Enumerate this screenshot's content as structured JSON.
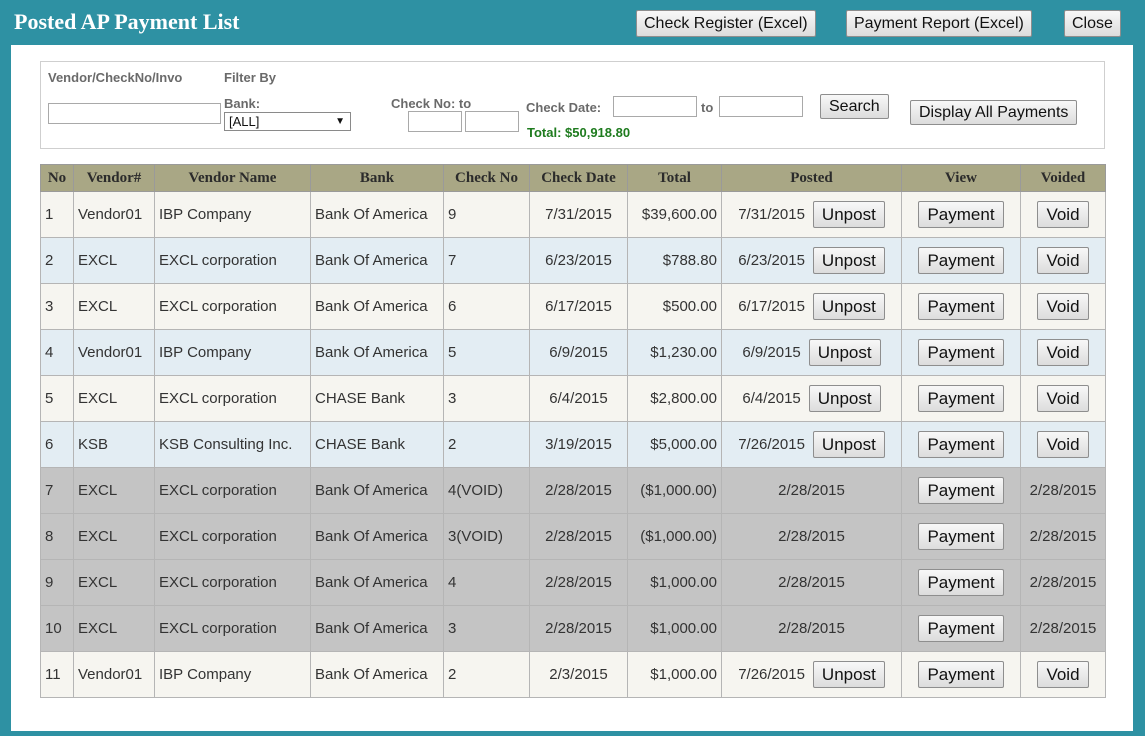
{
  "header": {
    "title": "Posted AP Payment List",
    "check_register_label": "Check Register (Excel)",
    "payment_report_label": "Payment Report (Excel)",
    "close_label": "Close"
  },
  "filter": {
    "vendor_label": "Vendor/CheckNo/Invo",
    "vendor_value": "",
    "filter_by_label": "Filter By",
    "bank_label": "Bank:",
    "bank_selected": "[ALL]",
    "check_no_label": "Check No: to",
    "check_no_from": "",
    "check_no_to": "",
    "check_date_label": "Check Date:",
    "check_date_from": "",
    "to_label": "to",
    "check_date_to": "",
    "search_label": "Search",
    "display_all_label": "Display All Payments",
    "total_text": "Total: $50,918.80"
  },
  "table": {
    "columns": [
      "No",
      "Vendor#",
      "Vendor Name",
      "Bank",
      "Check No",
      "Check Date",
      "Total",
      "Posted",
      "View",
      "Voided"
    ],
    "unpost_label": "Unpost",
    "payment_label": "Payment",
    "void_label": "Void",
    "rows": [
      {
        "no": "1",
        "vendor": "Vendor01",
        "vendor_name": "IBP Company",
        "bank": "Bank Of America",
        "check_no": "9",
        "check_date": "7/31/2015",
        "total": "$39,600.00",
        "posted": "7/31/2015",
        "voided": "",
        "is_void": false
      },
      {
        "no": "2",
        "vendor": "EXCL",
        "vendor_name": "EXCL corporation",
        "bank": "Bank Of America",
        "check_no": "7",
        "check_date": "6/23/2015",
        "total": "$788.80",
        "posted": "6/23/2015",
        "voided": "",
        "is_void": false
      },
      {
        "no": "3",
        "vendor": "EXCL",
        "vendor_name": "EXCL corporation",
        "bank": "Bank Of America",
        "check_no": "6",
        "check_date": "6/17/2015",
        "total": "$500.00",
        "posted": "6/17/2015",
        "voided": "",
        "is_void": false
      },
      {
        "no": "4",
        "vendor": "Vendor01",
        "vendor_name": "IBP Company",
        "bank": "Bank Of America",
        "check_no": "5",
        "check_date": "6/9/2015",
        "total": "$1,230.00",
        "posted": "6/9/2015",
        "voided": "",
        "is_void": false
      },
      {
        "no": "5",
        "vendor": "EXCL",
        "vendor_name": "EXCL corporation",
        "bank": "CHASE Bank",
        "check_no": "3",
        "check_date": "6/4/2015",
        "total": "$2,800.00",
        "posted": "6/4/2015",
        "voided": "",
        "is_void": false
      },
      {
        "no": "6",
        "vendor": "KSB",
        "vendor_name": "KSB Consulting Inc.",
        "bank": "CHASE Bank",
        "check_no": "2",
        "check_date": "3/19/2015",
        "total": "$5,000.00",
        "posted": "7/26/2015",
        "voided": "",
        "is_void": false
      },
      {
        "no": "7",
        "vendor": "EXCL",
        "vendor_name": "EXCL corporation",
        "bank": "Bank Of America",
        "check_no": "4(VOID)",
        "check_date": "2/28/2015",
        "total": "($1,000.00)",
        "posted": "2/28/2015",
        "voided": "2/28/2015",
        "is_void": true
      },
      {
        "no": "8",
        "vendor": "EXCL",
        "vendor_name": "EXCL corporation",
        "bank": "Bank Of America",
        "check_no": "3(VOID)",
        "check_date": "2/28/2015",
        "total": "($1,000.00)",
        "posted": "2/28/2015",
        "voided": "2/28/2015",
        "is_void": true
      },
      {
        "no": "9",
        "vendor": "EXCL",
        "vendor_name": "EXCL corporation",
        "bank": "Bank Of America",
        "check_no": "4",
        "check_date": "2/28/2015",
        "total": "$1,000.00",
        "posted": "2/28/2015",
        "voided": "2/28/2015",
        "is_void": true
      },
      {
        "no": "10",
        "vendor": "EXCL",
        "vendor_name": "EXCL corporation",
        "bank": "Bank Of America",
        "check_no": "3",
        "check_date": "2/28/2015",
        "total": "$1,000.00",
        "posted": "2/28/2015",
        "voided": "2/28/2015",
        "is_void": true
      },
      {
        "no": "11",
        "vendor": "Vendor01",
        "vendor_name": "IBP Company",
        "bank": "Bank Of America",
        "check_no": "2",
        "check_date": "2/3/2015",
        "total": "$1,000.00",
        "posted": "7/26/2015",
        "voided": "",
        "is_void": false
      }
    ]
  },
  "colors": {
    "frame": "#2e91a3",
    "header_row": "#a9a785",
    "row_odd": "#f6f5f0",
    "row_even": "#e3edf3",
    "row_void": "#c4c4c4",
    "total_text": "#1e7b1e"
  }
}
